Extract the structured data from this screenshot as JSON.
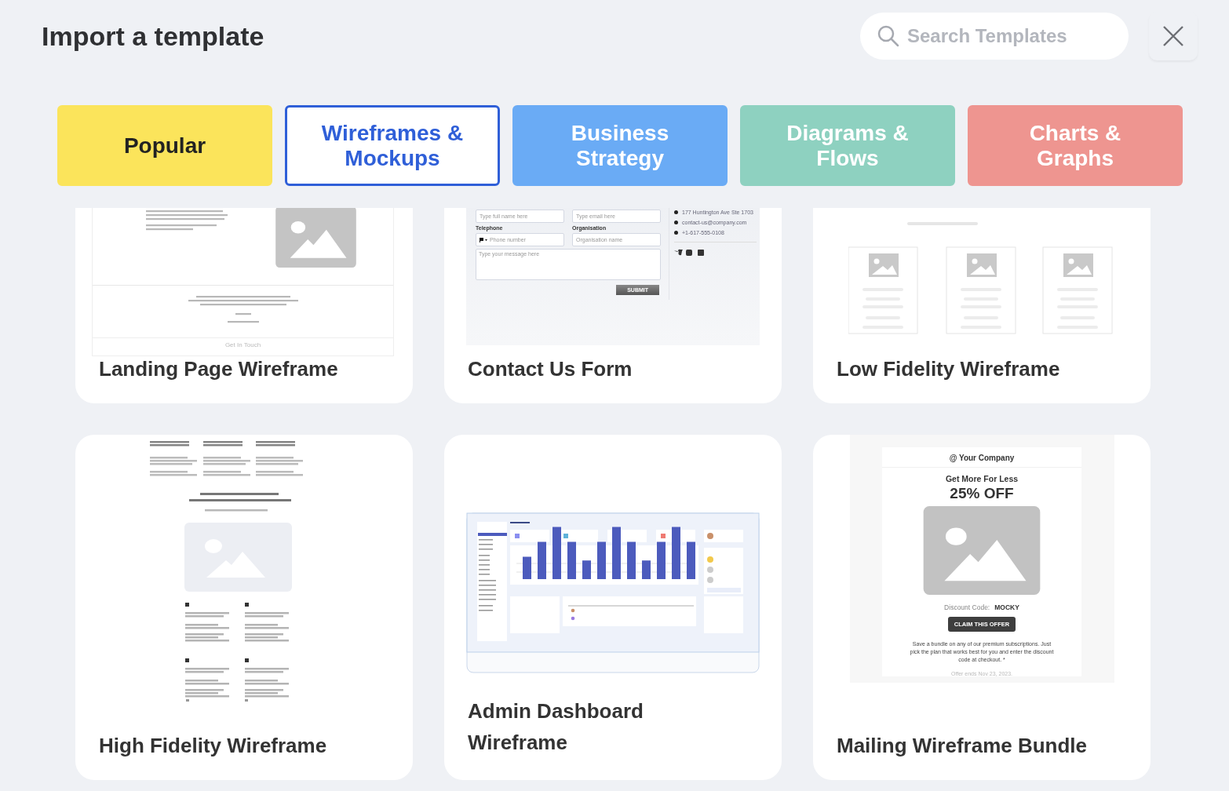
{
  "header": {
    "title": "Import a template",
    "search": {
      "placeholder": "Search Templates"
    }
  },
  "tabs": [
    {
      "label": "Popular",
      "color": "#fbe45b",
      "selected": false
    },
    {
      "label": "Wireframes & Mockups",
      "color": "#2f5fd8",
      "selected": true
    },
    {
      "label": "Business Strategy",
      "color": "#6aabf5",
      "selected": false
    },
    {
      "label": "Diagrams & Flows",
      "color": "#8ed1c0",
      "selected": false
    },
    {
      "label": "Charts & Graphs",
      "color": "#ee9590",
      "selected": false
    }
  ],
  "templates": [
    {
      "title": "Landing Page Wireframe",
      "preview": {
        "kind": "landing",
        "footer": "Get In Touch"
      }
    },
    {
      "title": "Contact Us Form",
      "preview": {
        "kind": "contact",
        "fields": [
          "Type full name here",
          "Type email here"
        ],
        "labels": [
          "Telephone",
          "Organisation"
        ],
        "fields_2": [
          "Phone number",
          "Organisation name"
        ],
        "message": "Type your message here",
        "button": "SUBMIT",
        "contacts": [
          "177 Huntington Ave Ste 1703",
          "contact-us@company.com",
          "+1-617-555-0108"
        ]
      }
    },
    {
      "title": "Low Fidelity Wireframe",
      "preview": {
        "kind": "lowfi"
      }
    },
    {
      "title": "High Fidelity Wireframe",
      "preview": {
        "kind": "hifi"
      }
    },
    {
      "title": "Admin Dashboard Wireframe",
      "preview": {
        "kind": "dashboard"
      }
    },
    {
      "title": "Mailing Wireframe Bundle",
      "preview": {
        "kind": "mailing",
        "brand": "@ Your Company",
        "headline": "Get More For Less",
        "offer": "25% OFF",
        "code_label": "Discount Code:",
        "code": "MOCKY",
        "button": "CLAIM THIS OFFER",
        "body": "Save a bundle on any of our premium subscriptions. Just pick the plan that works best for you and enter the discount code at checkout. *",
        "note": "Offer ends Nov 23, 2023."
      }
    }
  ]
}
